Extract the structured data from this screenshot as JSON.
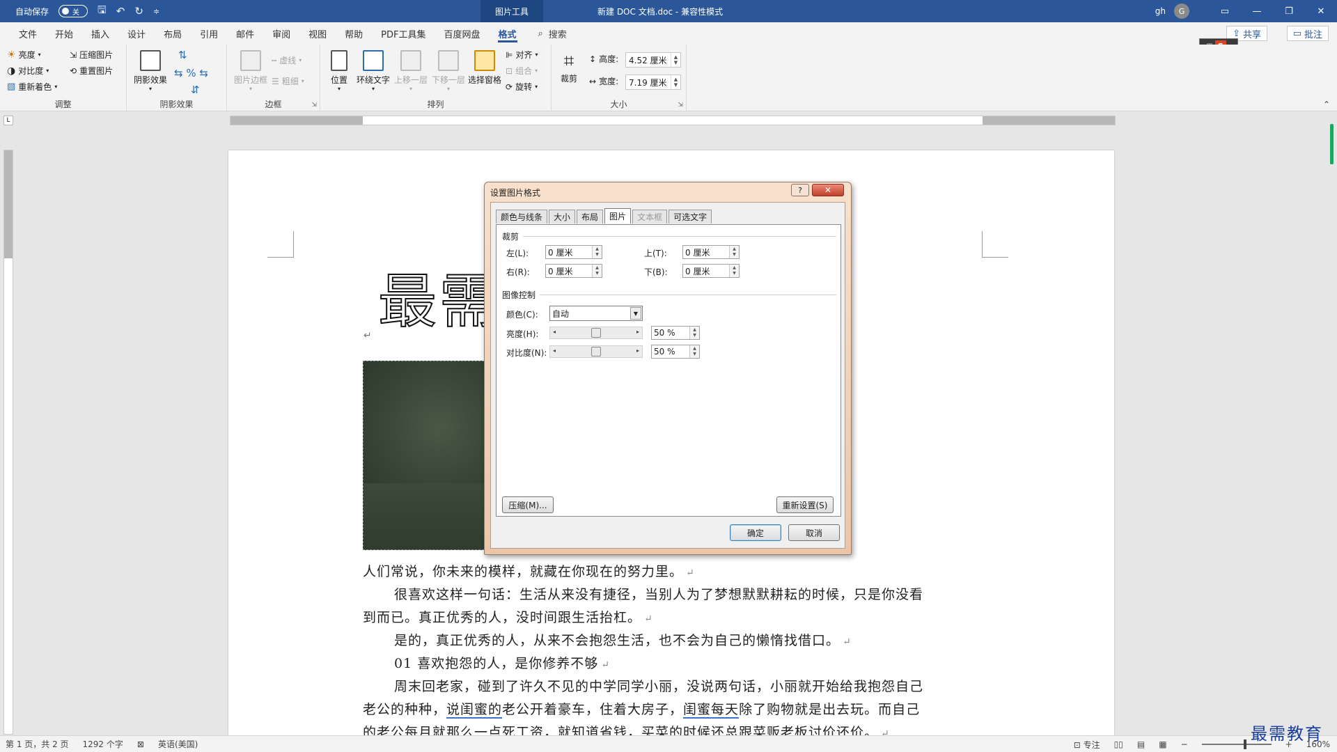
{
  "titlebar": {
    "autosave_label": "自动保存",
    "autosave_state": "关",
    "context_tab": "图片工具",
    "doc_title": "新建 DOC 文档.doc",
    "separator": "-",
    "mode": "兼容性模式",
    "user": "gh",
    "avatar_letter": "G"
  },
  "menu": {
    "tabs": [
      "文件",
      "开始",
      "插入",
      "设计",
      "布局",
      "引用",
      "邮件",
      "审阅",
      "视图",
      "帮助",
      "PDF工具集",
      "百度网盘",
      "格式"
    ],
    "search": "搜索",
    "share": "共享",
    "comment": "批注"
  },
  "ribbon": {
    "adjust": {
      "label": "调整",
      "brightness": "亮度",
      "contrast": "对比度",
      "recolor": "重新着色",
      "compress": "压缩图片",
      "reset": "重置图片"
    },
    "shadow": {
      "label": "阴影效果",
      "button": "阴影效果"
    },
    "border": {
      "label": "边框",
      "picture_border": "图片边框",
      "dashes": "虚线",
      "weight": "粗细"
    },
    "arrange": {
      "label": "排列",
      "position": "位置",
      "wrap": "环绕文字",
      "bring_forward": "上移一层",
      "send_backward": "下移一层",
      "selection_pane": "选择窗格",
      "align": "对齐",
      "group": "组合",
      "rotate": "旋转"
    },
    "size": {
      "label": "大小",
      "crop": "裁剪",
      "height_label": "高度:",
      "height_value": "4.52 厘米",
      "width_label": "宽度:",
      "width_value": "7.19 厘米"
    }
  },
  "document": {
    "heading": "最需",
    "lines": [
      "人们常说，你未来的模样，就藏在你现在的努力里。",
      "很喜欢这样一句话：生活从来没有捷径，当别人为了梦想默默耕耘的时候，只是你没看",
      "到而已。真正优秀的人，没时间跟生活抬杠。",
      "是的，真正优秀的人，从来不会抱怨生活，也不会为自己的懒惰找借口。",
      "喜欢抱怨的人，是你修养不够",
      "周末回老家，碰到了许久不见的中学同学小丽，没说两句话，小丽就开始给我抱怨自己",
      "的老公每月就那么一点死工资，就知道省钱，买菜的时候还总跟菜贩老板讨价还价。"
    ],
    "subheading_number": "01",
    "line7": {
      "a": "老公的种种，",
      "b": "说闺蜜的",
      "c": "老公开着豪车，住着大房子，",
      "d": "闺蜜每天",
      "e": "除了购物就是出去玩。而自己"
    }
  },
  "dialog": {
    "title": "设置图片格式",
    "help": "?",
    "close": "✕",
    "tabs": [
      "颜色与线条",
      "大小",
      "布局",
      "图片",
      "文本框",
      "可选文字"
    ],
    "active_tab": "图片",
    "crop_section": "裁剪",
    "left_label": "左(L):",
    "left_value": "0 厘米",
    "right_label": "右(R):",
    "right_value": "0 厘米",
    "top_label": "上(T):",
    "top_value": "0 厘米",
    "bottom_label": "下(B):",
    "bottom_value": "0 厘米",
    "image_section": "图像控制",
    "color_label": "颜色(C):",
    "color_value": "自动",
    "brightness_label": "亮度(H):",
    "brightness_value": "50 %",
    "brightness_level": 0.5,
    "contrast_label": "对比度(N):",
    "contrast_value": "50 %",
    "contrast_level": 0.5,
    "compress_btn": "压缩(M)...",
    "reset_btn": "重新设置(S)",
    "ok_btn": "确定",
    "cancel_btn": "取消"
  },
  "statusbar": {
    "page": "第 1 页，共 2 页",
    "words": "1292 个字",
    "language": "英语(美国)",
    "focus": "专注",
    "zoom": "160%"
  },
  "watermark": "最需教育",
  "colors": {
    "title_bar": "#2b579a",
    "accent": "#2b579a",
    "dialog_close": "#c2402a",
    "scroll_thumb": "#1fa463"
  }
}
